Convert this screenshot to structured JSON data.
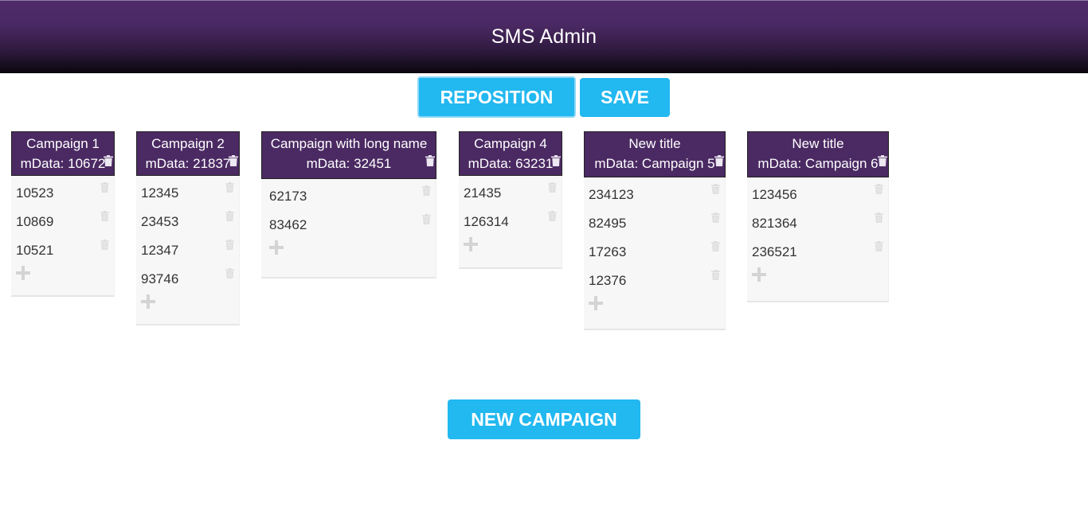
{
  "header": {
    "title": "SMS Admin"
  },
  "toolbar": {
    "reposition_label": "REPOSITION",
    "save_label": "SAVE"
  },
  "new_campaign_label": "NEW CAMPAIGN",
  "campaigns": [
    {
      "title": "Campaign 1",
      "mdata": "mData: 10672",
      "items": [
        "10523",
        "10869",
        "10521"
      ]
    },
    {
      "title": "Campaign 2",
      "mdata": "mData: 21837",
      "items": [
        "12345",
        "23453",
        "12347",
        "93746"
      ]
    },
    {
      "title": "Campaign with long name",
      "mdata": "mData: 32451",
      "items": [
        "62173",
        "83462"
      ]
    },
    {
      "title": "Campaign 4",
      "mdata": "mData: 63231",
      "items": [
        "21435",
        "126314"
      ]
    },
    {
      "title": "New title",
      "mdata": "mData: Campaign 5",
      "items": [
        "234123",
        "82495",
        "17263",
        "12376"
      ]
    },
    {
      "title": "New title",
      "mdata": "mData: Campaign 6",
      "items": [
        "123456",
        "821364",
        "236521"
      ]
    }
  ],
  "colors": {
    "accent": "#22b8f0",
    "header_purple": "#4b2a63",
    "panel_bg": "#f7f7f7"
  },
  "icons": {
    "delete": "trash-icon",
    "add": "plus-icon"
  }
}
